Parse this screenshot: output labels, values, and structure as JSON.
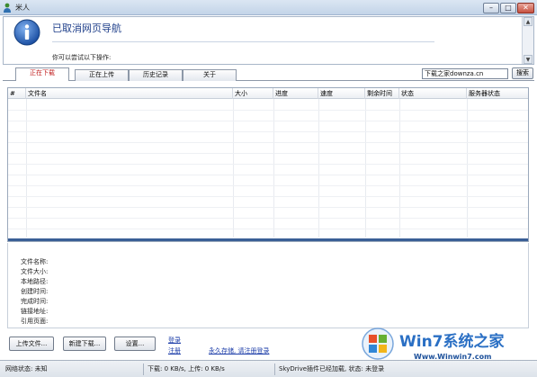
{
  "window": {
    "title": "米人",
    "min_glyph": "–",
    "max_glyph": "□",
    "close_glyph": "✕"
  },
  "browser": {
    "heading": "已取消网页导航",
    "hint": "你可以尝试以下操作:",
    "icon": "info-icon",
    "scroll_up": "▲",
    "scroll_down": "▼"
  },
  "tabs": [
    {
      "label": "正在下载",
      "active": true
    },
    {
      "label": "正在上传",
      "active": false
    },
    {
      "label": "历史记录",
      "active": false
    },
    {
      "label": "关于",
      "active": false
    }
  ],
  "search": {
    "value": "下载之家downza.cn",
    "button": "搜索"
  },
  "filelist": {
    "columns": [
      "#",
      "文件名",
      "大小",
      "进度",
      "速度",
      "剩余时间",
      "状态",
      "服务器状态"
    ]
  },
  "details": {
    "labels": [
      "文件名称:",
      "文件大小:",
      "本地路径:",
      "创建时间:",
      "完成时间:",
      "链接地址:",
      "引用页面:"
    ]
  },
  "buttons": {
    "upload": "上传文件...",
    "new_download": "新建下载...",
    "settings": "设置..."
  },
  "links": {
    "login": "登录",
    "register": "注册",
    "promo": "永久存储, 请注册登录"
  },
  "logo": {
    "brand": "Win7系统之家",
    "url": "Www.Winwin7.com"
  },
  "status": {
    "network": "网络状态: 未知",
    "speed": "下载: 0 KB/s, 上传: 0 KB/s",
    "plugin": "SkyDrive插件已经加载, 状态: 未登录"
  },
  "colors": {
    "accent": "#1b3ca8",
    "active_tab": "#c02020",
    "list_bottom": "#3a5f96"
  }
}
